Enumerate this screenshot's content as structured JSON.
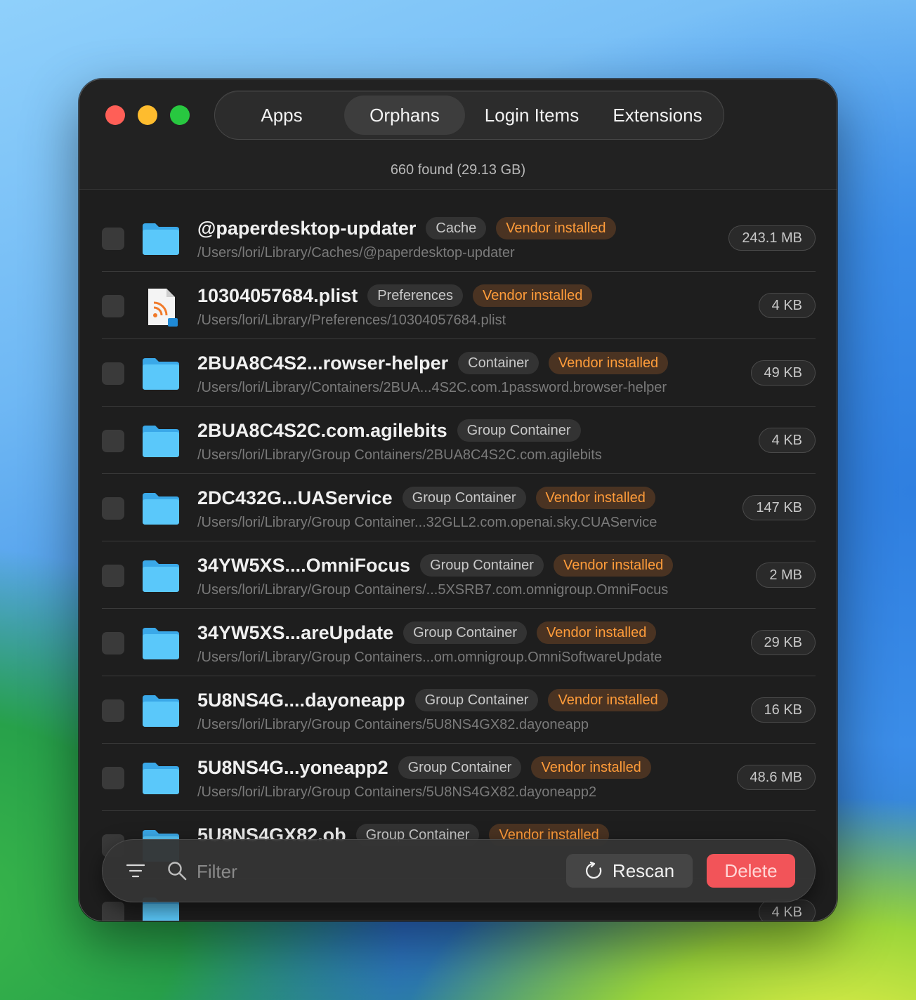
{
  "window": {
    "tabs": [
      {
        "label": "Apps",
        "active": false
      },
      {
        "label": "Orphans",
        "active": true
      },
      {
        "label": "Login Items",
        "active": false
      },
      {
        "label": "Extensions",
        "active": false
      }
    ],
    "summary": "660 found (29.13 GB)"
  },
  "items": [
    {
      "name": "@paperdesktop-updater",
      "kind": "Cache",
      "vendor": "Vendor installed",
      "path": "/Users/lori/Library/Caches/@paperdesktop-updater",
      "size": "243.1 MB",
      "icon": "folder-icon"
    },
    {
      "name": "10304057684.plist",
      "kind": "Preferences",
      "vendor": "Vendor installed",
      "path": "/Users/lori/Library/Preferences/10304057684.plist",
      "size": "4 KB",
      "icon": "plist-file-icon"
    },
    {
      "name": "2BUA8C4S2...rowser-helper",
      "kind": "Container",
      "vendor": "Vendor installed",
      "path": "/Users/lori/Library/Containers/2BUA...4S2C.com.1password.browser-helper",
      "size": "49 KB",
      "icon": "folder-icon"
    },
    {
      "name": "2BUA8C4S2C.com.agilebits",
      "kind": "Group Container",
      "vendor": "",
      "path": "/Users/lori/Library/Group Containers/2BUA8C4S2C.com.agilebits",
      "size": "4 KB",
      "icon": "folder-icon"
    },
    {
      "name": "2DC432G...UAService",
      "kind": "Group Container",
      "vendor": "Vendor installed",
      "path": "/Users/lori/Library/Group Container...32GLL2.com.openai.sky.CUAService",
      "size": "147 KB",
      "icon": "folder-icon"
    },
    {
      "name": "34YW5XS....OmniFocus",
      "kind": "Group Container",
      "vendor": "Vendor installed",
      "path": "/Users/lori/Library/Group Containers/...5XSRB7.com.omnigroup.OmniFocus",
      "size": "2 MB",
      "icon": "folder-icon"
    },
    {
      "name": "34YW5XS...areUpdate",
      "kind": "Group Container",
      "vendor": "Vendor installed",
      "path": "/Users/lori/Library/Group Containers...om.omnigroup.OmniSoftwareUpdate",
      "size": "29 KB",
      "icon": "folder-icon"
    },
    {
      "name": "5U8NS4G....dayoneapp",
      "kind": "Group Container",
      "vendor": "Vendor installed",
      "path": "/Users/lori/Library/Group Containers/5U8NS4GX82.dayoneapp",
      "size": "16 KB",
      "icon": "folder-icon"
    },
    {
      "name": "5U8NS4G...yoneapp2",
      "kind": "Group Container",
      "vendor": "Vendor installed",
      "path": "/Users/lori/Library/Group Containers/5U8NS4GX82.dayoneapp2",
      "size": "48.6 MB",
      "icon": "folder-icon"
    },
    {
      "name": "5U8NS4GX82.ob",
      "kind": "Group Container",
      "vendor": "Vendor installed",
      "path": "",
      "size": "",
      "icon": "folder-icon"
    },
    {
      "name": "",
      "kind": "",
      "vendor": "",
      "path": "",
      "size": "4 KB",
      "icon": "folder-icon"
    }
  ],
  "toolbar": {
    "filter_placeholder": "Filter",
    "rescan_label": "Rescan",
    "delete_label": "Delete",
    "filter_menu_icon": "filter-lines-icon",
    "search_icon": "search-icon",
    "rescan_icon": "refresh-icon"
  },
  "colors": {
    "accent_orange": "#ff9c3a",
    "delete_red": "#f25459",
    "folder_blue": "#5ac8fa"
  }
}
